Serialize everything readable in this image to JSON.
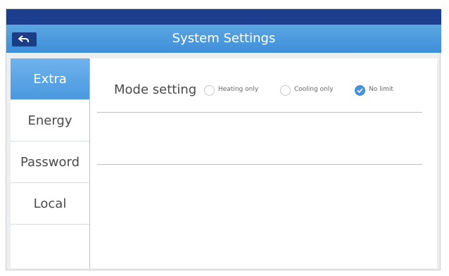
{
  "header": {
    "title": "System Settings",
    "back_icon": "back-arrow-icon"
  },
  "sidebar": {
    "items": [
      {
        "label": "Extra",
        "active": true
      },
      {
        "label": "Energy",
        "active": false
      },
      {
        "label": "Password",
        "active": false
      },
      {
        "label": "Local",
        "active": false
      }
    ]
  },
  "main": {
    "mode_label": "Mode setting",
    "options": [
      {
        "label": "Heating only",
        "checked": false
      },
      {
        "label": "Cooling only",
        "checked": false
      },
      {
        "label": "No limit",
        "checked": true
      }
    ]
  },
  "colors": {
    "accent": "#4a98df",
    "topbar": "#1d3e8c"
  }
}
